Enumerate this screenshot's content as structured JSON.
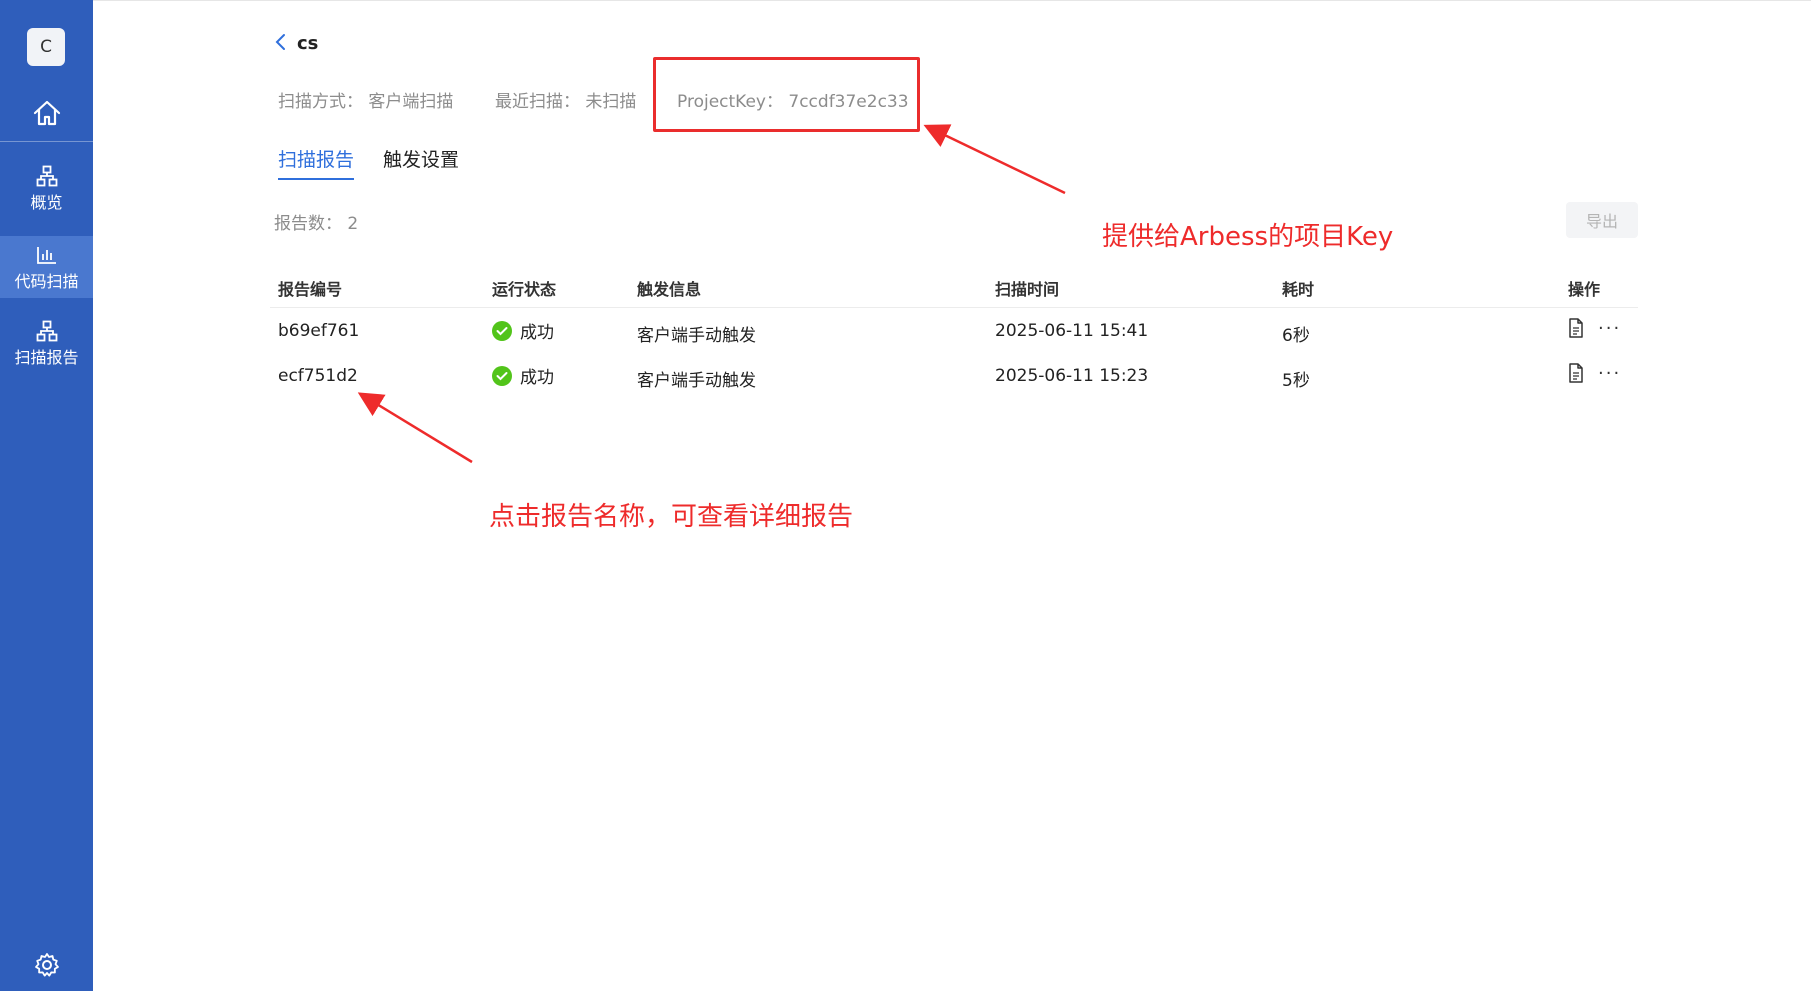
{
  "colors": {
    "sidebar": "#2f5ebb",
    "sidebar_active": "#4a78cf",
    "accent": "#2f6fdc",
    "success": "#52c41a",
    "annotation": "#ee2b2b"
  },
  "sidebar": {
    "avatar_letter": "C",
    "home_icon": "home-icon",
    "items": [
      {
        "label": "概览",
        "icon": "org-icon",
        "active": false
      },
      {
        "label": "代码扫描",
        "icon": "bar-chart-icon",
        "active": true
      },
      {
        "label": "扫描报告",
        "icon": "org-icon",
        "active": false
      }
    ],
    "settings_icon": "gear-icon"
  },
  "header": {
    "back_icon": "chevron-left-icon",
    "title": "cs"
  },
  "meta": {
    "scan_method": "扫描方式：  客户端扫描",
    "recent_scan": "最近扫描：  未扫描",
    "project_key": "ProjectKey：  7ccdf37e2c33"
  },
  "tabs": [
    {
      "label": "扫描报告",
      "active": true
    },
    {
      "label": "触发设置",
      "active": false
    }
  ],
  "report_count": "报告数：  2",
  "export_label": "导出",
  "table": {
    "columns": [
      "报告编号",
      "运行状态",
      "触发信息",
      "扫描时间",
      "耗时",
      "操作"
    ],
    "rows": [
      {
        "id": "b69ef761",
        "status": "成功",
        "trigger": "客户端手动触发",
        "time": "2025-06-11 15:41",
        "duration": "6秒"
      },
      {
        "id": "ecf751d2",
        "status": "成功",
        "trigger": "客户端手动触发",
        "time": "2025-06-11 15:23",
        "duration": "5秒"
      }
    ],
    "action_icons": [
      "document-icon",
      "more-icon"
    ],
    "more_glyph": "···"
  },
  "annotations": {
    "project_key_note": "提供给Arbess的项目Key",
    "report_note": "点击报告名称，可查看详细报告"
  }
}
